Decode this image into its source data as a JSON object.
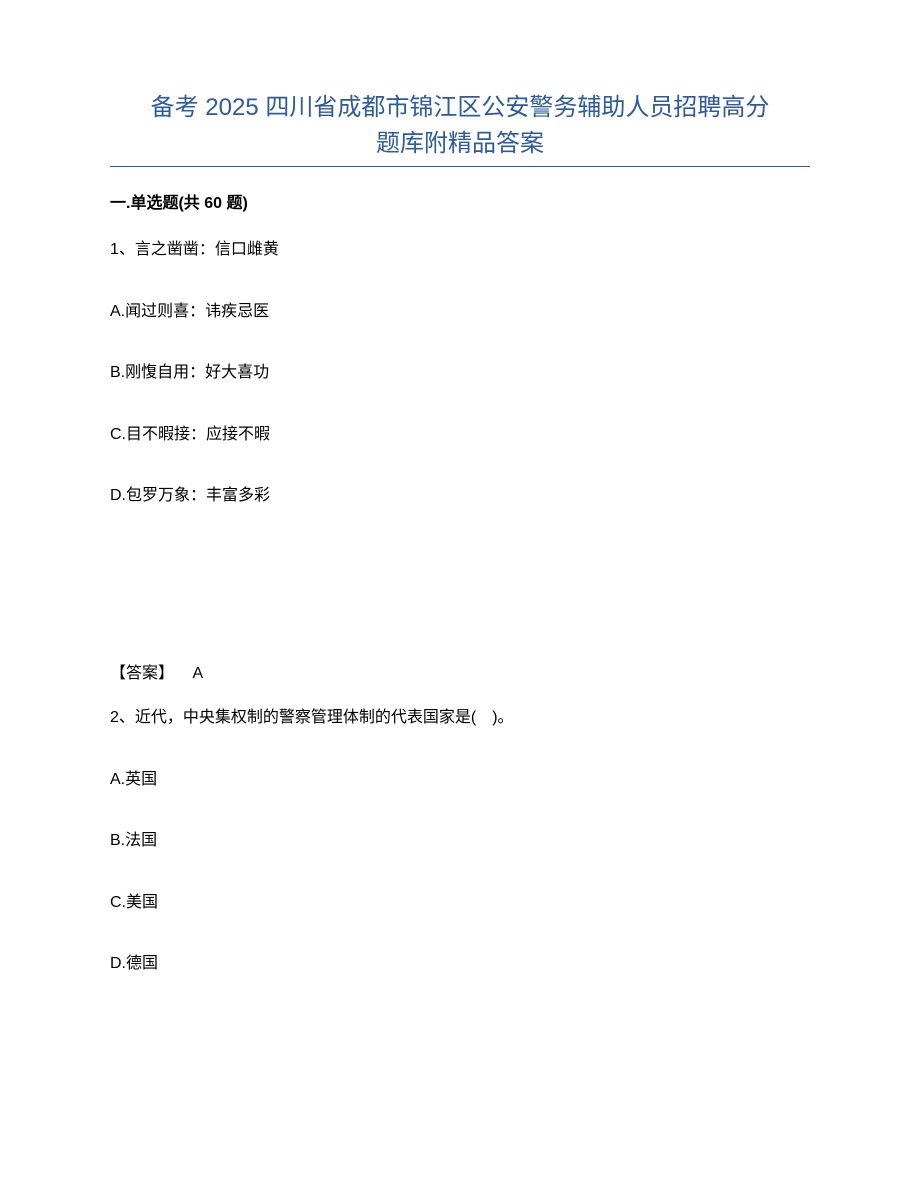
{
  "title_line1": "备考 2025 四川省成都市锦江区公安警务辅助人员招聘高分",
  "title_line2": "题库附精品答案",
  "section_header": "一.单选题(共 60 题)",
  "q1": {
    "stem": "1、言之凿凿：信口雌黄",
    "options": {
      "A": "A.闻过则喜：讳疾忌医",
      "B": "B.刚愎自用：好大喜功",
      "C": "C.目不暇接：应接不暇",
      "D": "D.包罗万象：丰富多彩"
    },
    "answer_label": "【答案】",
    "answer_value": "A"
  },
  "q2": {
    "stem": "2、近代，中央集权制的警察管理体制的代表国家是(　)。",
    "options": {
      "A": "A.英国",
      "B": "B.法国",
      "C": "C.美国",
      "D": "D.德国"
    }
  }
}
